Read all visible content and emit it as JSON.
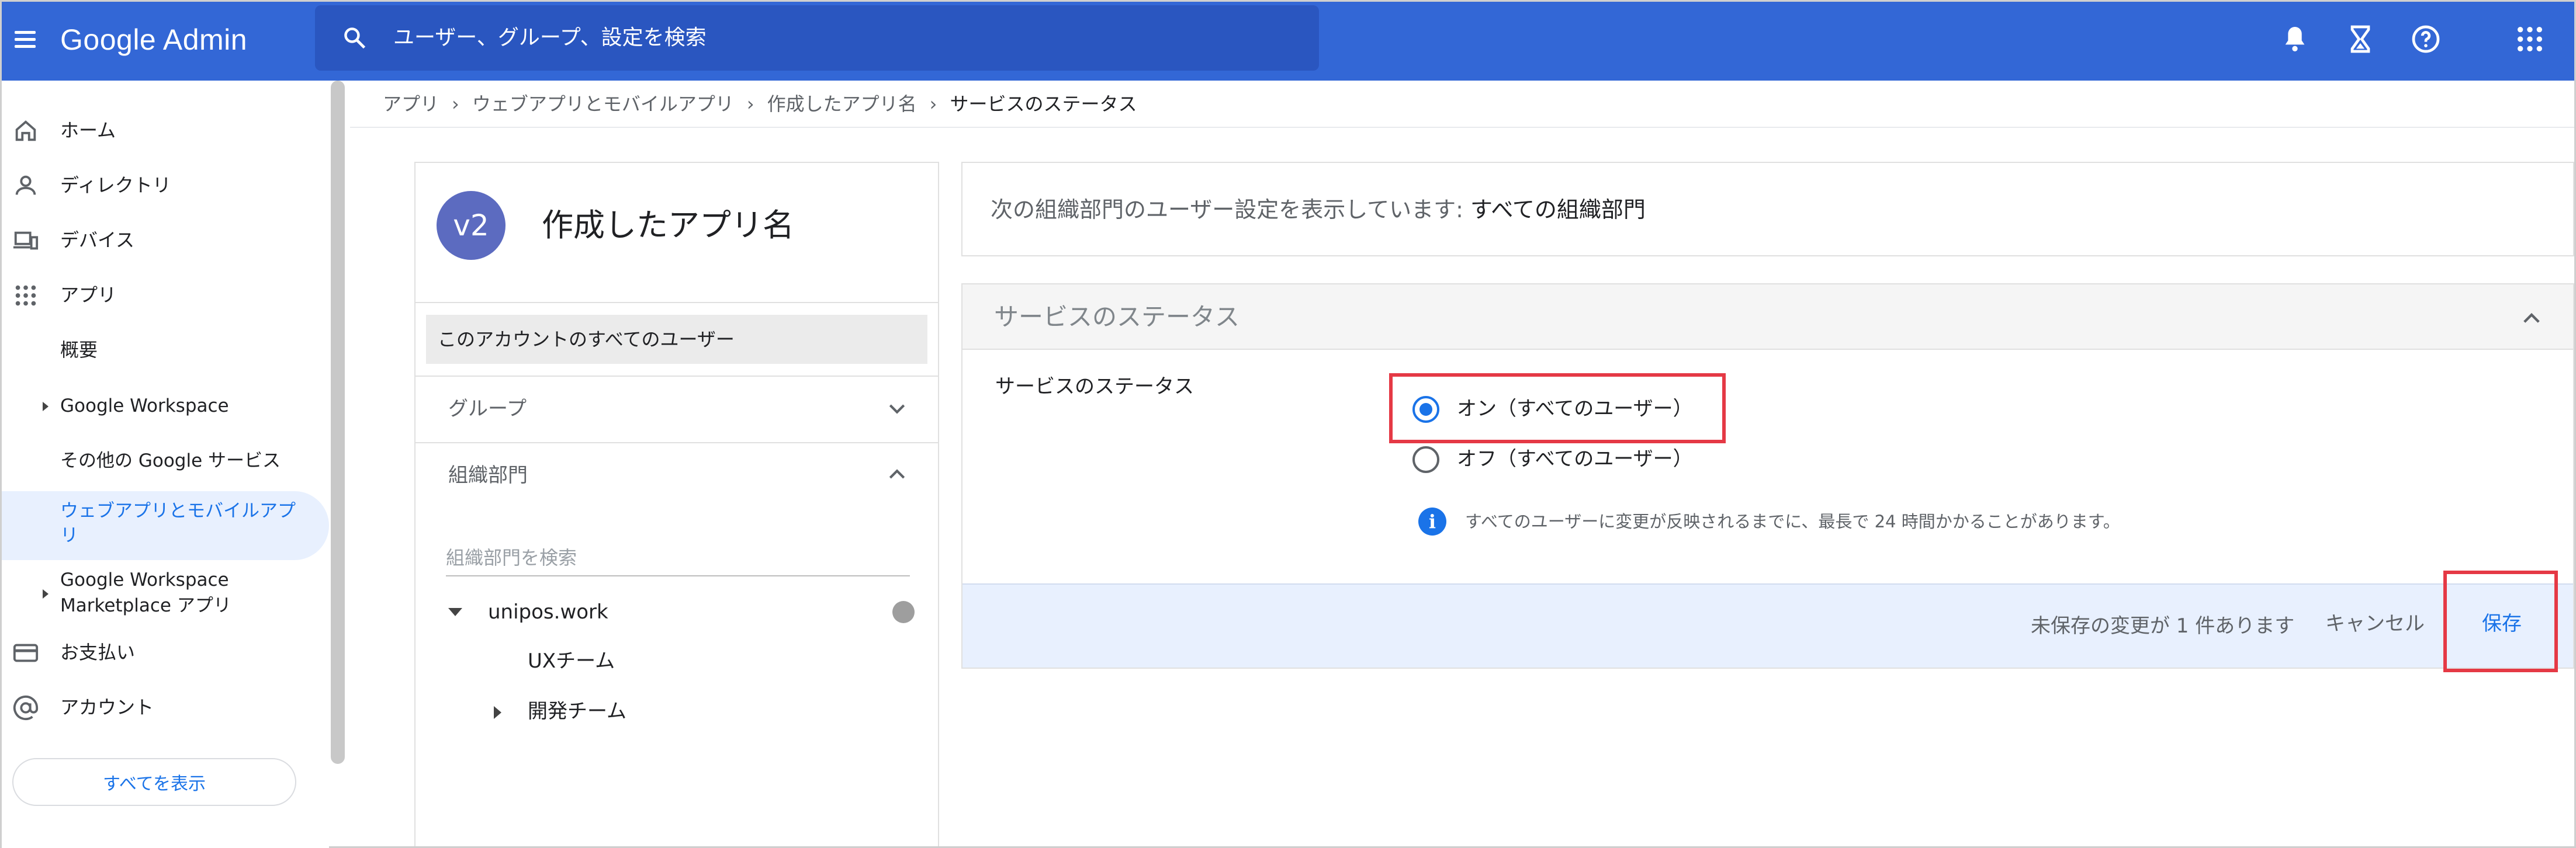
{
  "header": {
    "logo_text": "Google Admin",
    "search_placeholder": "ユーザー、グループ、設定を検索"
  },
  "sidebar": {
    "items": [
      {
        "label": "ホーム",
        "icon": "home-icon"
      },
      {
        "label": "ディレクトリ",
        "icon": "person-icon"
      },
      {
        "label": "デバイス",
        "icon": "devices-icon"
      },
      {
        "label": "アプリ",
        "icon": "apps-grid-icon"
      },
      {
        "label": "概要"
      },
      {
        "label": "Google Workspace"
      },
      {
        "label": "その他の Google サービス"
      },
      {
        "label_line1": "ウェブアプリとモバイルアプ",
        "label_line2": "リ"
      },
      {
        "label_line1": "Google Workspace",
        "label_line2": "Marketplace アプリ"
      },
      {
        "label": "お支払い",
        "icon": "credit-card-icon"
      },
      {
        "label": "アカウント",
        "icon": "at-sign-icon"
      }
    ],
    "show_all": "すべてを表示"
  },
  "breadcrumb": {
    "items": [
      "アプリ",
      "ウェブアプリとモバイルアプリ",
      "作成したアプリ名"
    ],
    "current": "サービスのステータス"
  },
  "app_panel": {
    "avatar_text": "v2",
    "app_name": "作成したアプリ名",
    "all_users": "このアカウントのすべてのユーザー",
    "groups_label": "グループ",
    "org_units_label": "組織部門",
    "org_search_placeholder": "組織部門を検索",
    "tree": {
      "root": "unipos.work",
      "children": [
        "UXチーム",
        "開発チーム"
      ]
    }
  },
  "info_bar": {
    "prefix": "次の組織部門のユーザー設定を表示しています:",
    "org": "すべての組織部門"
  },
  "status_card": {
    "title": "サービスのステータス",
    "row_label": "サービスのステータス",
    "options": [
      {
        "label": "オン（すべてのユーザー）",
        "selected": true
      },
      {
        "label": "オフ（すべてのユーザー）",
        "selected": false
      }
    ],
    "note": "すべてのユーザーに変更が反映されるまでに、最長で 24 時間かかることがあります。",
    "unsaved": "未保存の変更が 1 件あります",
    "cancel": "キャンセル",
    "save": "保存"
  },
  "colors": {
    "topbar": "#3367d6",
    "accent": "#1a73e8",
    "highlight": "#e53945"
  }
}
